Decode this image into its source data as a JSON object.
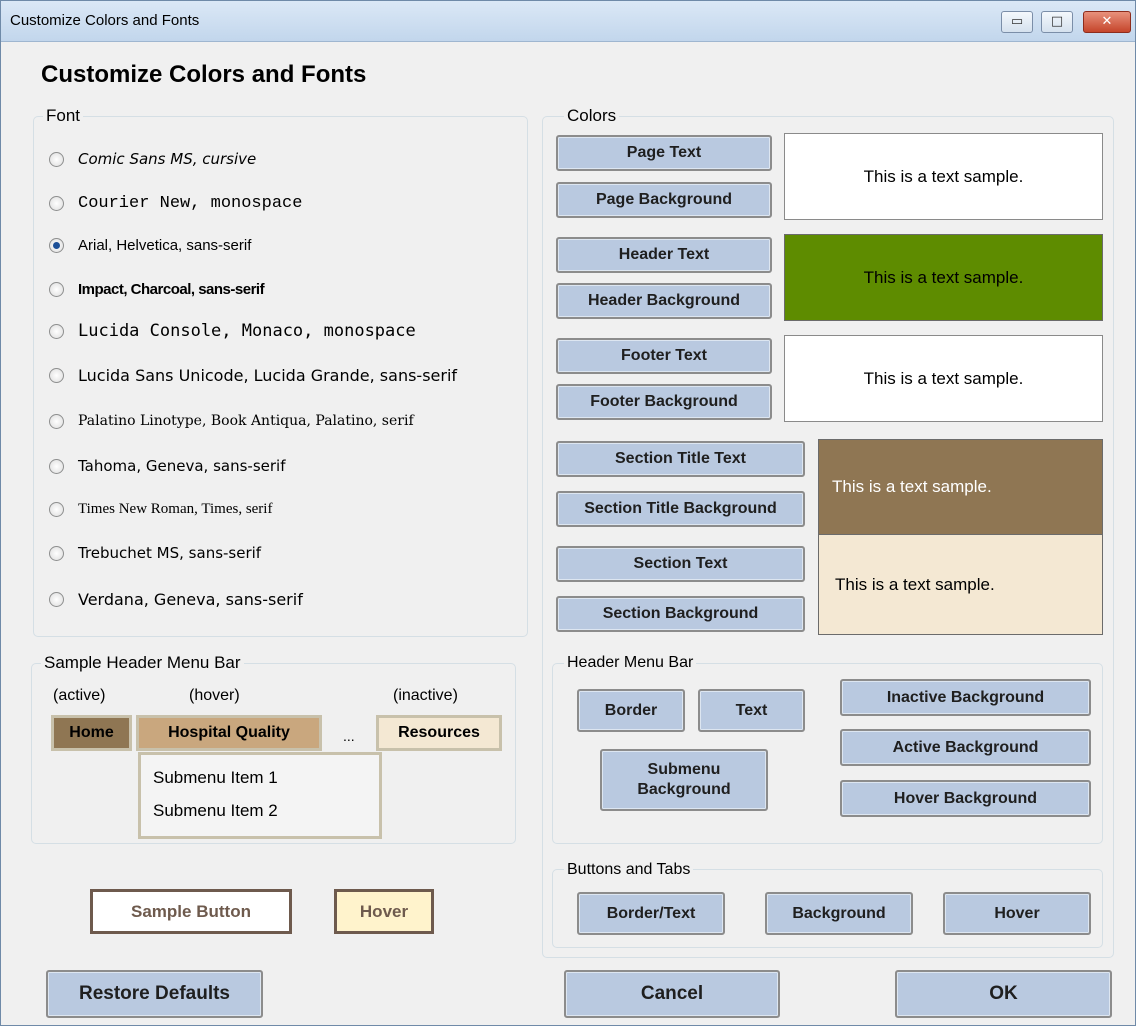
{
  "window": {
    "title": "Customize Colors and Fonts",
    "min_glyph": "▭",
    "max_glyph": "□",
    "close_glyph": "✕"
  },
  "heading": "Customize Colors and Fonts",
  "font_group": {
    "title": "Font",
    "options": [
      {
        "label": "Comic Sans MS, cursive",
        "checked": false
      },
      {
        "label": "Courier New, monospace",
        "checked": false
      },
      {
        "label": "Arial, Helvetica, sans-serif",
        "checked": true
      },
      {
        "label": "Impact, Charcoal, sans-serif",
        "checked": false
      },
      {
        "label": "Lucida Console, Monaco, monospace",
        "checked": false
      },
      {
        "label": "Lucida Sans Unicode, Lucida Grande, sans-serif",
        "checked": false
      },
      {
        "label": "Palatino Linotype, Book Antiqua, Palatino, serif",
        "checked": false
      },
      {
        "label": "Tahoma, Geneva, sans-serif",
        "checked": false
      },
      {
        "label": "Times New Roman, Times, serif",
        "checked": false
      },
      {
        "label": "Trebuchet MS, sans-serif",
        "checked": false
      },
      {
        "label": "Verdana, Geneva, sans-serif",
        "checked": false
      }
    ]
  },
  "colors_group": {
    "title": "Colors",
    "page_text": "Page Text",
    "page_background": "Page Background",
    "header_text": "Header Text",
    "header_background": "Header Background",
    "footer_text": "Footer Text",
    "footer_background": "Footer Background",
    "section_title_text": "Section Title Text",
    "section_title_background": "Section Title Background",
    "section_text": "Section Text",
    "section_background": "Section Background",
    "sample_text": "This is a text sample.",
    "colors": {
      "page_bg": "#ffffff",
      "page_fg": "#000000",
      "header_bg": "#5e8c00",
      "header_fg": "#000000",
      "footer_bg": "#ffffff",
      "footer_fg": "#000000",
      "section_title_bg": "#8f7653",
      "section_title_fg": "#ffffff",
      "section_bg": "#f4e8d3",
      "section_fg": "#000000"
    }
  },
  "sample_menu": {
    "title": "Sample Header Menu Bar",
    "active_label": "(active)",
    "hover_label": "(hover)",
    "inactive_label": "(inactive)",
    "home": "Home",
    "hospital_quality": "Hospital Quality",
    "ellipsis": "...",
    "resources": "Resources",
    "submenu_1": "Submenu Item 1",
    "submenu_2": "Submenu Item 2",
    "colors": {
      "active_bg": "#8f7653",
      "hover_bg": "#c9a77e",
      "inactive_bg": "#f4e8d3",
      "border": "#c8c1ab"
    }
  },
  "header_menu_bar": {
    "title": "Header Menu Bar",
    "border": "Border",
    "text": "Text",
    "submenu_background": "Submenu Background",
    "inactive_background": "Inactive Background",
    "active_background": "Active Background",
    "hover_background": "Hover Background"
  },
  "buttons_tabs": {
    "title": "Buttons and Tabs",
    "border_text": "Border/Text",
    "background": "Background",
    "hover": "Hover"
  },
  "sample_buttons": {
    "sample": "Sample Button",
    "hover": "Hover",
    "colors": {
      "sample_bg": "#ffffff",
      "sample_fg": "#6e5a4d",
      "hover_bg": "#fff3cc",
      "border": "#6e5a4d"
    }
  },
  "footer": {
    "restore": "Restore Defaults",
    "cancel": "Cancel",
    "ok": "OK"
  }
}
